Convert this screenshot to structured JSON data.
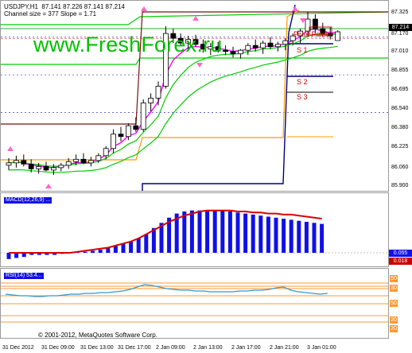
{
  "header": {
    "line1": "USDJPY,H1  87.141 87.226 87.141 87.214",
    "line2": "Channel size = 377 Slope = 1.71"
  },
  "watermark": "www.FreshForex.ru",
  "labels": {
    "s1": "S 1",
    "s2": "S 2",
    "s3": "S 3",
    "pivot": "Pivot Point"
  },
  "subwindows": {
    "macd_label": "MACD(12,26,9) ...",
    "osc_label": "RSI(14) 53.4..."
  },
  "price_axis": {
    "ticks": [
      "87.325",
      "87.170",
      "87.010",
      "86.855",
      "86.695",
      "86.540",
      "86.380",
      "86.225",
      "86.060",
      "85.900"
    ],
    "current_price": "87.214"
  },
  "macd_axis": {
    "badges": [
      "0.055",
      "0.018"
    ]
  },
  "osc_axis": {
    "levels": [
      "50",
      "30",
      "50",
      "20",
      "20"
    ]
  },
  "time_axis": {
    "ticks": [
      "31 Dec 2012",
      "31 Dec 09:00",
      "31 Dec 13:00",
      "31 Dec 17:00",
      "2 Jan 09:00",
      "2 Jan 13:00",
      "2 Jan 17:00",
      "2 Jan 21:00",
      "3 Jan 01:00"
    ]
  },
  "copyright": "© 2001-2012, MetaQuotes Software Corp.",
  "chart_data": [
    {
      "type": "candlestick",
      "symbol": "USDJPY",
      "timeframe": "H1",
      "ohlc_last": {
        "open": 87.141,
        "high": 87.226,
        "low": 87.141,
        "close": 87.214
      },
      "ylim": [
        85.9,
        87.38
      ],
      "y_ticks": [
        87.325,
        87.17,
        87.01,
        86.855,
        86.695,
        86.54,
        86.38,
        86.225,
        86.06,
        85.9
      ],
      "candles": [
        {
          "o": 86.1,
          "h": 86.16,
          "l": 86.06,
          "c": 86.12
        },
        {
          "o": 86.12,
          "h": 86.18,
          "l": 86.08,
          "c": 86.14
        },
        {
          "o": 86.14,
          "h": 86.19,
          "l": 86.09,
          "c": 86.11
        },
        {
          "o": 86.11,
          "h": 86.15,
          "l": 86.04,
          "c": 86.07
        },
        {
          "o": 86.07,
          "h": 86.12,
          "l": 86.03,
          "c": 86.09
        },
        {
          "o": 86.09,
          "h": 86.13,
          "l": 86.05,
          "c": 86.06
        },
        {
          "o": 86.06,
          "h": 86.11,
          "l": 86.02,
          "c": 86.08
        },
        {
          "o": 86.08,
          "h": 86.12,
          "l": 86.05,
          "c": 86.1
        },
        {
          "o": 86.1,
          "h": 86.16,
          "l": 86.07,
          "c": 86.13
        },
        {
          "o": 86.13,
          "h": 86.19,
          "l": 86.1,
          "c": 86.15
        },
        {
          "o": 86.15,
          "h": 86.2,
          "l": 86.11,
          "c": 86.12
        },
        {
          "o": 86.12,
          "h": 86.17,
          "l": 86.09,
          "c": 86.14
        },
        {
          "o": 86.14,
          "h": 86.2,
          "l": 86.12,
          "c": 86.18
        },
        {
          "o": 86.18,
          "h": 86.26,
          "l": 86.15,
          "c": 86.24
        },
        {
          "o": 86.24,
          "h": 86.4,
          "l": 86.2,
          "c": 86.36
        },
        {
          "o": 86.36,
          "h": 86.42,
          "l": 86.3,
          "c": 86.34
        },
        {
          "o": 86.34,
          "h": 86.45,
          "l": 86.31,
          "c": 86.43
        },
        {
          "o": 86.43,
          "h": 86.5,
          "l": 86.38,
          "c": 86.4
        },
        {
          "o": 86.4,
          "h": 86.65,
          "l": 86.38,
          "c": 86.62
        },
        {
          "o": 86.62,
          "h": 86.7,
          "l": 86.55,
          "c": 86.66
        },
        {
          "o": 86.66,
          "h": 86.8,
          "l": 86.6,
          "c": 86.76
        },
        {
          "o": 86.76,
          "h": 87.26,
          "l": 86.74,
          "c": 87.2
        },
        {
          "o": 87.2,
          "h": 87.24,
          "l": 87.12,
          "c": 87.16
        },
        {
          "o": 87.16,
          "h": 87.2,
          "l": 87.1,
          "c": 87.12
        },
        {
          "o": 87.12,
          "h": 87.18,
          "l": 87.06,
          "c": 87.15
        },
        {
          "o": 87.15,
          "h": 87.19,
          "l": 87.09,
          "c": 87.11
        },
        {
          "o": 87.11,
          "h": 87.15,
          "l": 87.04,
          "c": 87.07
        },
        {
          "o": 87.07,
          "h": 87.12,
          "l": 87.02,
          "c": 87.09
        },
        {
          "o": 87.09,
          "h": 87.13,
          "l": 87.04,
          "c": 87.06
        },
        {
          "o": 87.06,
          "h": 87.1,
          "l": 87.02,
          "c": 87.05
        },
        {
          "o": 87.05,
          "h": 87.09,
          "l": 87.0,
          "c": 87.03
        },
        {
          "o": 87.03,
          "h": 87.07,
          "l": 86.99,
          "c": 87.06
        },
        {
          "o": 87.06,
          "h": 87.12,
          "l": 87.02,
          "c": 87.1
        },
        {
          "o": 87.1,
          "h": 87.15,
          "l": 87.05,
          "c": 87.08
        },
        {
          "o": 87.08,
          "h": 87.14,
          "l": 87.03,
          "c": 87.12
        },
        {
          "o": 87.12,
          "h": 87.17,
          "l": 87.07,
          "c": 87.09
        },
        {
          "o": 87.09,
          "h": 87.13,
          "l": 87.05,
          "c": 87.11
        },
        {
          "o": 87.11,
          "h": 87.16,
          "l": 87.06,
          "c": 87.14
        },
        {
          "o": 87.14,
          "h": 87.2,
          "l": 87.1,
          "c": 87.18
        },
        {
          "o": 87.18,
          "h": 87.24,
          "l": 87.12,
          "c": 87.22
        },
        {
          "o": 87.22,
          "h": 87.38,
          "l": 87.18,
          "c": 87.32
        },
        {
          "o": 87.32,
          "h": 87.36,
          "l": 87.2,
          "c": 87.24
        },
        {
          "o": 87.24,
          "h": 87.29,
          "l": 87.17,
          "c": 87.2
        },
        {
          "o": 87.2,
          "h": 87.25,
          "l": 87.15,
          "c": 87.18
        },
        {
          "o": 87.141,
          "h": 87.226,
          "l": 87.141,
          "c": 87.214
        }
      ]
    },
    {
      "type": "bar",
      "name": "histogram",
      "values": [
        -0.006,
        -0.005,
        -0.004,
        -0.002,
        -0.002,
        -0.002,
        -0.002,
        -0.001,
        0.0,
        0.001,
        0.001,
        0.002,
        0.003,
        0.005,
        0.007,
        0.009,
        0.011,
        0.014,
        0.018,
        0.024,
        0.029,
        0.034,
        0.038,
        0.04,
        0.041,
        0.041,
        0.041,
        0.041,
        0.041,
        0.04,
        0.039,
        0.038,
        0.037,
        0.036,
        0.035,
        0.034,
        0.033,
        0.032,
        0.031,
        0.03,
        0.029,
        0.028
      ],
      "signal": [
        0.0,
        0.0,
        0.0,
        0.0,
        0.0,
        0.0,
        0.0,
        0.0,
        0.0,
        0.001,
        0.002,
        0.003,
        0.004,
        0.005,
        0.007,
        0.009,
        0.011,
        0.014,
        0.018,
        0.022,
        0.026,
        0.03,
        0.033,
        0.036,
        0.038,
        0.04,
        0.041,
        0.041,
        0.041,
        0.041,
        0.04,
        0.04,
        0.039,
        0.039,
        0.038,
        0.038,
        0.037,
        0.037,
        0.036,
        0.035,
        0.034,
        0.033
      ],
      "ylim": [
        -0.01,
        0.05
      ]
    },
    {
      "type": "line",
      "name": "oscillator",
      "values": [
        52,
        51,
        50,
        50,
        49,
        49,
        50,
        50,
        51,
        52,
        52,
        53,
        53,
        54,
        54,
        55,
        56,
        58,
        61,
        64,
        63,
        61,
        59,
        58,
        57,
        57,
        56,
        56,
        55,
        55,
        55,
        55,
        56,
        56,
        57,
        57,
        58,
        60,
        61,
        57,
        55,
        54,
        53,
        52,
        53
      ],
      "levels": [
        62,
        59,
        50,
        40,
        25
      ],
      "ylim": [
        0,
        80
      ]
    }
  ]
}
